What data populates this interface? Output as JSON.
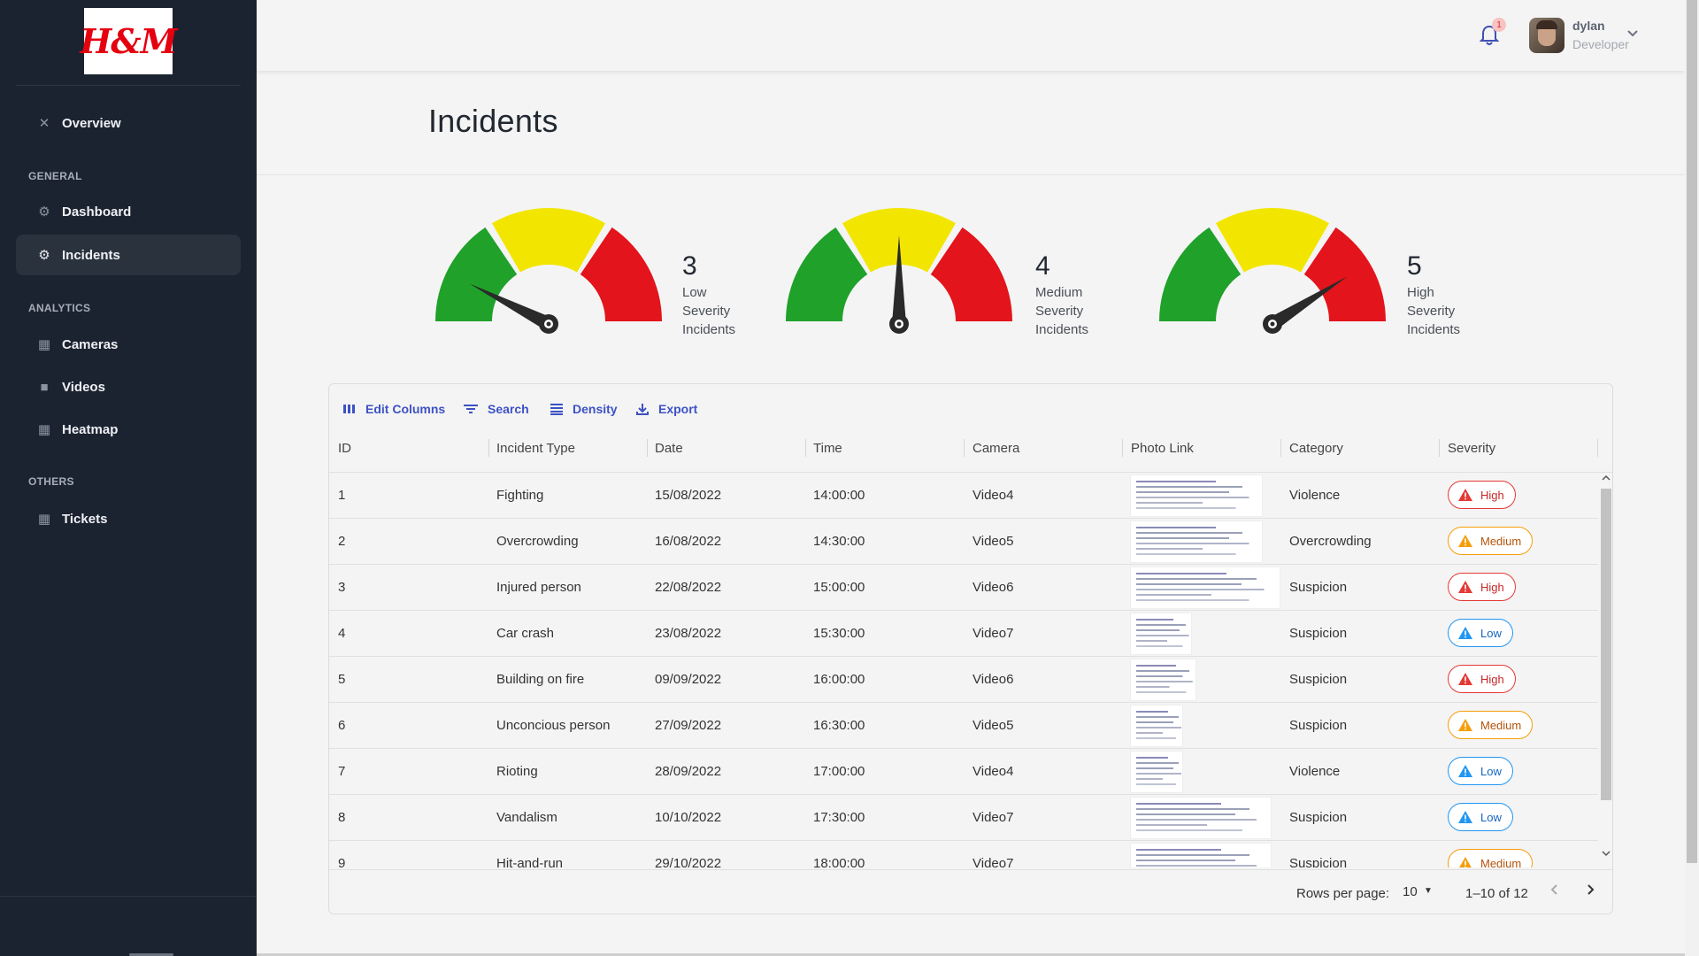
{
  "brand": {
    "logo_text": "H&M",
    "accent": "#3d52c4",
    "sidebar_bg": "#1b2330"
  },
  "sidebar": {
    "top_item": {
      "label": "Overview",
      "icon": "tools-icon"
    },
    "sections": [
      {
        "heading": "GENERAL",
        "items": [
          {
            "label": "Dashboard",
            "icon": "gear-icon"
          },
          {
            "label": "Incidents",
            "icon": "gear-icon",
            "active": true
          }
        ]
      },
      {
        "heading": "ANALYTICS",
        "items": [
          {
            "label": "Cameras",
            "icon": "chart-icon"
          },
          {
            "label": "Videos",
            "icon": "video-icon"
          },
          {
            "label": "Heatmap",
            "icon": "chart-icon"
          }
        ]
      },
      {
        "heading": "OTHERS",
        "items": [
          {
            "label": "Tickets",
            "icon": "chart-icon"
          }
        ]
      }
    ]
  },
  "topbar": {
    "notification_count": "1",
    "user": {
      "name": "dylan",
      "role": "Developer"
    }
  },
  "page": {
    "title": "Incidents"
  },
  "gauges": [
    {
      "count": "3",
      "label_line1": "Low Severity",
      "label_line2": "Incidents",
      "needle_level": 0.15
    },
    {
      "count": "4",
      "label_line1": "Medium Severity",
      "label_line2": "Incidents",
      "needle_level": 0.5
    },
    {
      "count": "5",
      "label_line1": "High Severity",
      "label_line2": "Incidents",
      "needle_level": 0.82
    }
  ],
  "gauge_colors": {
    "low": "#1fa12a",
    "medium": "#f2e600",
    "high": "#e3141b"
  },
  "toolbar": {
    "edit_columns": "Edit Columns",
    "search": "Search",
    "density": "Density",
    "export": "Export"
  },
  "table": {
    "columns": [
      "ID",
      "Incident Type",
      "Date",
      "Time",
      "Camera",
      "Photo Link",
      "Category",
      "Severity"
    ],
    "rows": [
      {
        "id": "1",
        "type": "Fighting",
        "date": "15/08/2022",
        "time": "14:00:00",
        "camera": "Video4",
        "category": "Violence",
        "severity": "High"
      },
      {
        "id": "2",
        "type": "Overcrowding",
        "date": "16/08/2022",
        "time": "14:30:00",
        "camera": "Video5",
        "category": "Overcrowding",
        "severity": "Medium"
      },
      {
        "id": "3",
        "type": "Injured person",
        "date": "22/08/2022",
        "time": "15:00:00",
        "camera": "Video6",
        "category": "Suspicion",
        "severity": "High"
      },
      {
        "id": "4",
        "type": "Car crash",
        "date": "23/08/2022",
        "time": "15:30:00",
        "camera": "Video7",
        "category": "Suspicion",
        "severity": "Low"
      },
      {
        "id": "5",
        "type": "Building on fire",
        "date": "09/09/2022",
        "time": "16:00:00",
        "camera": "Video6",
        "category": "Suspicion",
        "severity": "High"
      },
      {
        "id": "6",
        "type": "Unconcious person",
        "date": "27/09/2022",
        "time": "16:30:00",
        "camera": "Video5",
        "category": "Suspicion",
        "severity": "Medium"
      },
      {
        "id": "7",
        "type": "Rioting",
        "date": "28/09/2022",
        "time": "17:00:00",
        "camera": "Video4",
        "category": "Violence",
        "severity": "Low"
      },
      {
        "id": "8",
        "type": "Vandalism",
        "date": "10/10/2022",
        "time": "17:30:00",
        "camera": "Video7",
        "category": "Suspicion",
        "severity": "Low"
      },
      {
        "id": "9",
        "type": "Hit-and-run",
        "date": "29/10/2022",
        "time": "18:00:00",
        "camera": "Video7",
        "category": "Suspicion",
        "severity": "Medium"
      }
    ]
  },
  "pagination": {
    "rows_per_page_label": "Rows per page:",
    "rows_per_page": "10",
    "range": "1–10 of 12"
  }
}
